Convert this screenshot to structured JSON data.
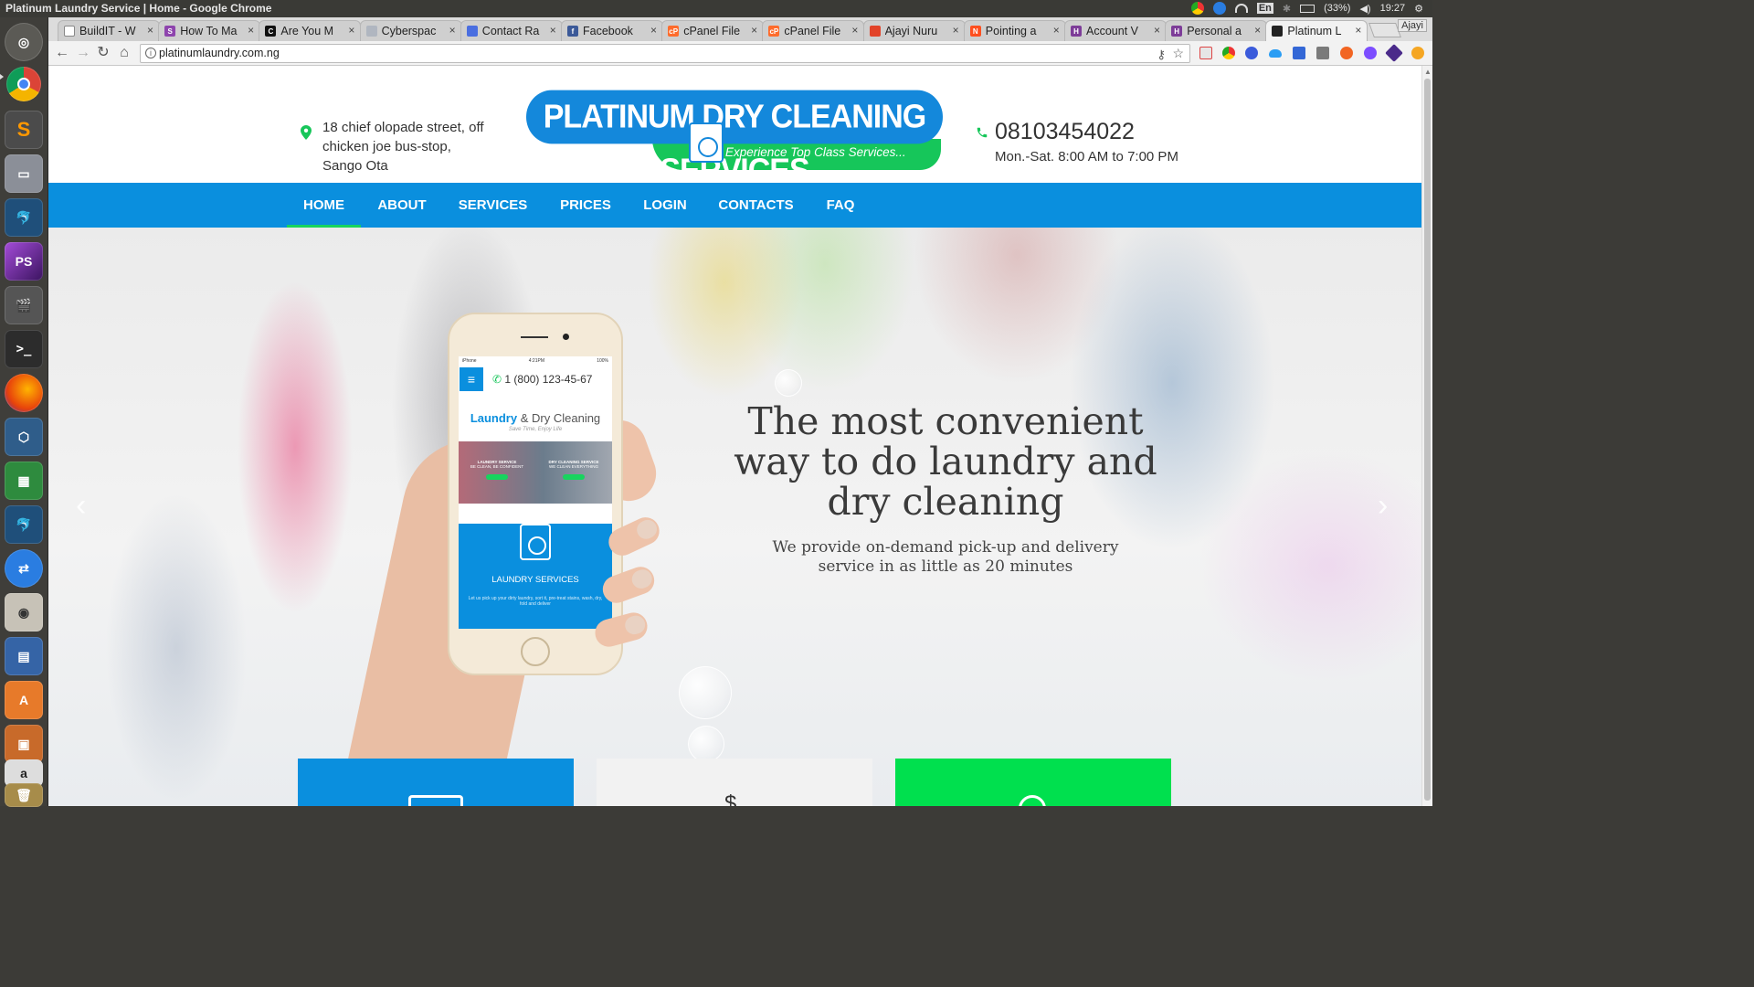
{
  "os": {
    "window_title": "Platinum Laundry Service | Home - Google Chrome",
    "lang": "En",
    "battery": "(33%)",
    "clock": "19:27",
    "user": "Ajayi"
  },
  "browser": {
    "tabs": [
      {
        "label": "BuildIT - W",
        "icon": "doc-icon"
      },
      {
        "label": "How To Ma",
        "icon": "s-icon"
      },
      {
        "label": "Are You M",
        "icon": "c-icon"
      },
      {
        "label": "Cyberspac",
        "icon": "web-icon"
      },
      {
        "label": "Contact Ra",
        "icon": "stripes-icon"
      },
      {
        "label": "Facebook",
        "icon": "facebook-icon"
      },
      {
        "label": "cPanel File",
        "icon": "cpanel-icon"
      },
      {
        "label": "cPanel File",
        "icon": "cpanel-icon"
      },
      {
        "label": "Ajayi Nuru",
        "icon": "gitlab-icon"
      },
      {
        "label": "Pointing a",
        "icon": "n-icon"
      },
      {
        "label": "Account V",
        "icon": "h-icon"
      },
      {
        "label": "Personal a",
        "icon": "h-icon"
      },
      {
        "label": "Platinum L",
        "icon": "platinum-icon"
      }
    ],
    "url": "platinumlaundry.com.ng"
  },
  "site": {
    "address": "18 chief olopade street, off chicken joe bus-stop, Sango Ota",
    "logo_title": "PLATINUM DRY CLEANING SERVICES",
    "logo_tagline": "Experience Top Class Services...",
    "phone": "08103454022",
    "hours": "Mon.-Sat. 8:00 AM to 7:00 PM",
    "nav": [
      "HOME",
      "ABOUT",
      "SERVICES",
      "PRICES",
      "LOGIN",
      "CONTACTS",
      "FAQ"
    ],
    "active_nav": "HOME",
    "hero_title": "The most convenient way to do laundry and dry cleaning",
    "hero_subtitle": "We provide on-demand pick-up and delivery service in as little as 20 minutes",
    "mockup": {
      "phone": "1 (800) 123-45-67",
      "logo_a": "Laundry",
      "logo_b": "& Dry Cleaning",
      "tagline": "Save Time, Enjoy Life",
      "promo_left": "LAUNDRY SERVICE",
      "promo_left_sub": "BE CLEAN, BE CONFIDENT",
      "promo_right": "DRY CLEANING SERVICE",
      "promo_right_sub": "WE CLEAN EVERYTHING",
      "promo_cta": "ORDER NOW",
      "service_title": "LAUNDRY SERVICES",
      "service_desc": "Let us pick up your dirty laundry, sort it, pre-treat stains, wash, dry, fold and deliver"
    }
  },
  "colors": {
    "brand_blue": "#0a8fde",
    "brand_green": "#17d45e",
    "card_colors": [
      "#0a8fde",
      "#f2f2f2",
      "#00e04e"
    ]
  }
}
